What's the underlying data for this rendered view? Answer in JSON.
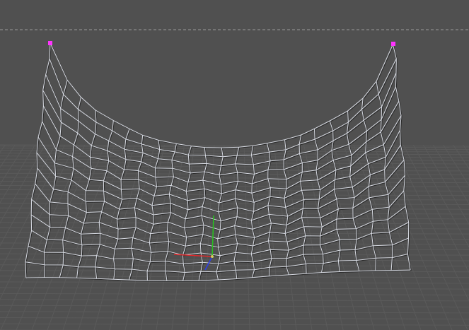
{
  "viewport": {
    "background_color": "#505050",
    "floor_grid_color": "#5a5a5a",
    "horizon_line_color": "#9a9a9a",
    "horizon_line_style": "dashed",
    "cloth_mesh": {
      "wire_color": "#d8dbe3",
      "shadow_color": "#2a2a2a",
      "rows": 15,
      "columns": 22
    },
    "pinned_vertex_color": "#ff33ff",
    "pinned_vertex_count": 2,
    "manipulator_gizmo": {
      "x_axis_color": "#e0282a",
      "y_axis_color": "#27c41e",
      "z_axis_color": "#2a3cf0"
    }
  }
}
